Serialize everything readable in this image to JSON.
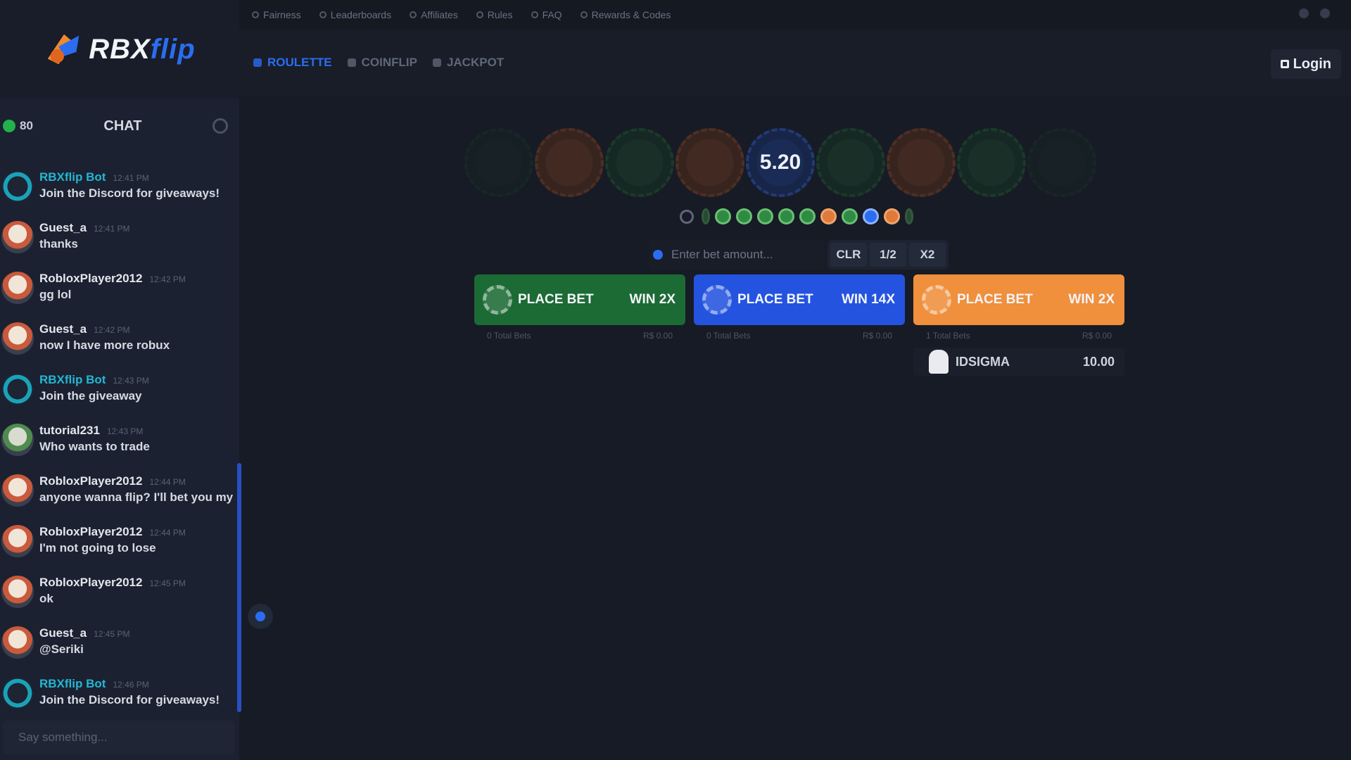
{
  "brand": {
    "part1": "RBX",
    "part2": "flip"
  },
  "topbar": {
    "items": [
      {
        "label": "Fairness",
        "icon": "shield-icon"
      },
      {
        "label": "Leaderboards",
        "icon": "trophy-icon"
      },
      {
        "label": "Affiliates",
        "icon": "users-icon"
      },
      {
        "label": "Rules",
        "icon": "book-icon"
      },
      {
        "label": "FAQ",
        "icon": "help-icon"
      },
      {
        "label": "Rewards & Codes",
        "icon": "gift-icon"
      }
    ]
  },
  "nav": {
    "tabs": [
      {
        "label": "ROULETTE",
        "active": true,
        "icon": "roulette-icon"
      },
      {
        "label": "COINFLIP",
        "active": false,
        "icon": "coin-icon"
      },
      {
        "label": "JACKPOT",
        "active": false,
        "icon": "jackpot-icon"
      }
    ],
    "login_label": "Login"
  },
  "chat": {
    "online_count": "80",
    "title": "CHAT",
    "input_placeholder": "Say something...",
    "messages": [
      {
        "user": "RBXflip Bot",
        "time": "12:41 PM",
        "text": "Join the Discord for giveaways!",
        "avatar": "teal",
        "staff": true
      },
      {
        "user": "Guest_a",
        "time": "12:41 PM",
        "text": "thanks",
        "avatar": "red",
        "staff": false
      },
      {
        "user": "RobloxPlayer2012",
        "time": "12:42 PM",
        "text": "gg lol",
        "avatar": "red",
        "staff": false
      },
      {
        "user": "Guest_a",
        "time": "12:42 PM",
        "text": "now I have more robux",
        "avatar": "red",
        "staff": false
      },
      {
        "user": "RBXflip Bot",
        "time": "12:43 PM",
        "text": "Join the giveaway",
        "avatar": "teal",
        "staff": true
      },
      {
        "user": "tutorial231",
        "time": "12:43 PM",
        "text": "Who wants to trade",
        "avatar": "green",
        "staff": false
      },
      {
        "user": "RobloxPlayer2012",
        "time": "12:44 PM",
        "text": "anyone wanna flip? I'll bet you my entire inventory",
        "avatar": "red",
        "staff": false
      },
      {
        "user": "RobloxPlayer2012",
        "time": "12:44 PM",
        "text": "I'm not going to lose",
        "avatar": "red",
        "staff": false
      },
      {
        "user": "RobloxPlayer2012",
        "time": "12:45 PM",
        "text": "ok",
        "avatar": "red",
        "staff": false
      },
      {
        "user": "Guest_a",
        "time": "12:45 PM",
        "text": "@Seriki",
        "avatar": "red",
        "staff": false
      },
      {
        "user": "RBXflip Bot",
        "time": "12:46 PM",
        "text": "Join the Discord for giveaways!",
        "avatar": "teal",
        "staff": true
      }
    ]
  },
  "roulette": {
    "countdown": "5.20",
    "strip": [
      {
        "color": "faint"
      },
      {
        "color": "orange"
      },
      {
        "color": "green"
      },
      {
        "color": "orange"
      },
      {
        "color": "blue",
        "label": "5.20"
      },
      {
        "color": "green"
      },
      {
        "color": "orange"
      },
      {
        "color": "green"
      },
      {
        "color": "faint"
      }
    ],
    "history": [
      "dim",
      "green",
      "green",
      "green",
      "green",
      "green",
      "orange",
      "green",
      "blue",
      "orange",
      "dim"
    ]
  },
  "bet": {
    "placeholder": "Enter bet amount...",
    "quick_buttons": [
      "CLR",
      "1/2",
      "X2"
    ]
  },
  "panels": [
    {
      "color": "green",
      "label": "PLACE BET",
      "payout": "WIN 2X",
      "bets_label": "0 Total Bets",
      "total": "R$ 0.00"
    },
    {
      "color": "blue",
      "label": "PLACE BET",
      "payout": "WIN 14X",
      "bets_label": "0 Total Bets",
      "total": "R$ 0.00"
    },
    {
      "color": "orange",
      "label": "PLACE BET",
      "payout": "WIN 2X",
      "bets_label": "1 Total Bets",
      "total": "R$ 0.00"
    }
  ],
  "orange_player": {
    "name": "IDSIGMA",
    "amount": "10.00"
  }
}
